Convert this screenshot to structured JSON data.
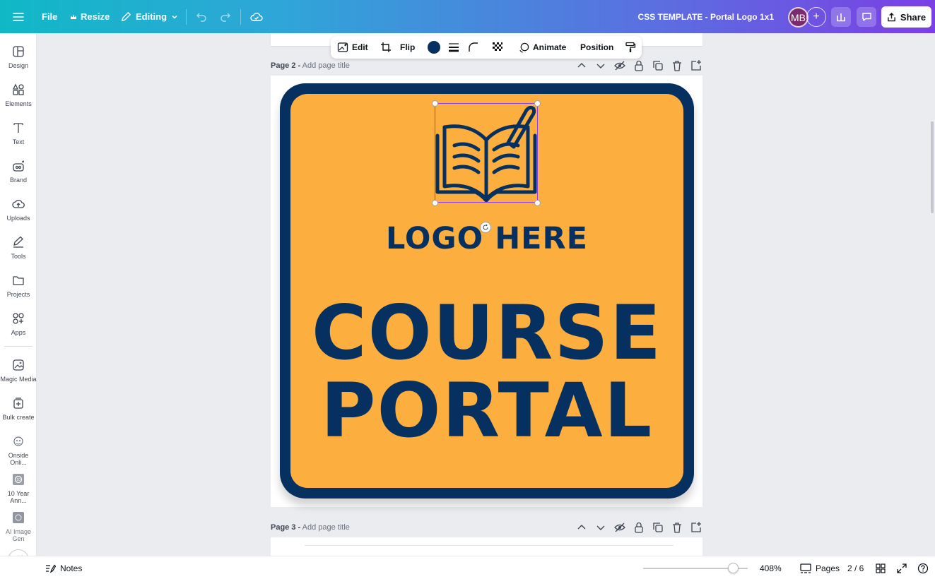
{
  "topbar": {
    "file_label": "File",
    "resize_label": "Resize",
    "editing_label": "Editing",
    "doc_title": "CSS TEMPLATE - Portal Logo 1x1",
    "avatar_initials": "MB",
    "share_label": "Share"
  },
  "sidebar": {
    "items": [
      {
        "label": "Design",
        "icon": "layout-icon"
      },
      {
        "label": "Elements",
        "icon": "shapes-icon"
      },
      {
        "label": "Text",
        "icon": "text-icon"
      },
      {
        "label": "Brand",
        "icon": "brand-icon"
      },
      {
        "label": "Uploads",
        "icon": "cloud-upload-icon"
      },
      {
        "label": "Tools",
        "icon": "pen-icon"
      },
      {
        "label": "Projects",
        "icon": "folder-icon"
      },
      {
        "label": "Apps",
        "icon": "apps-icon"
      },
      {
        "label": "Magic Media",
        "icon": "magic-media-icon"
      },
      {
        "label": "Bulk create",
        "icon": "bulk-create-icon"
      },
      {
        "label": "Onside Onli...",
        "icon": "app-thumbnail-icon"
      },
      {
        "label": "10 Year Ann...",
        "icon": "app-thumbnail-icon"
      },
      {
        "label": "AI Image Gen",
        "icon": "app-thumbnail-icon"
      }
    ]
  },
  "element_toolbar": {
    "edit_label": "Edit",
    "flip_label": "Flip",
    "animate_label": "Animate",
    "position_label": "Position",
    "color_swatch": "#05305f"
  },
  "pages": {
    "page2_label": "Page 2 -",
    "page2_add_title": "Add page title",
    "page3_label": "Page 3 -",
    "page3_add_title": "Add page title"
  },
  "design": {
    "logo_text": "LOGO HERE",
    "line1": "COURSE",
    "line2": "PORTAL",
    "primary_color": "#05305f",
    "background_color": "#fcaf3f"
  },
  "bottombar": {
    "notes_label": "Notes",
    "zoom_value": "408%",
    "zoom_level": 0.86,
    "pages_label": "Pages",
    "page_indicator": "2 / 6"
  }
}
